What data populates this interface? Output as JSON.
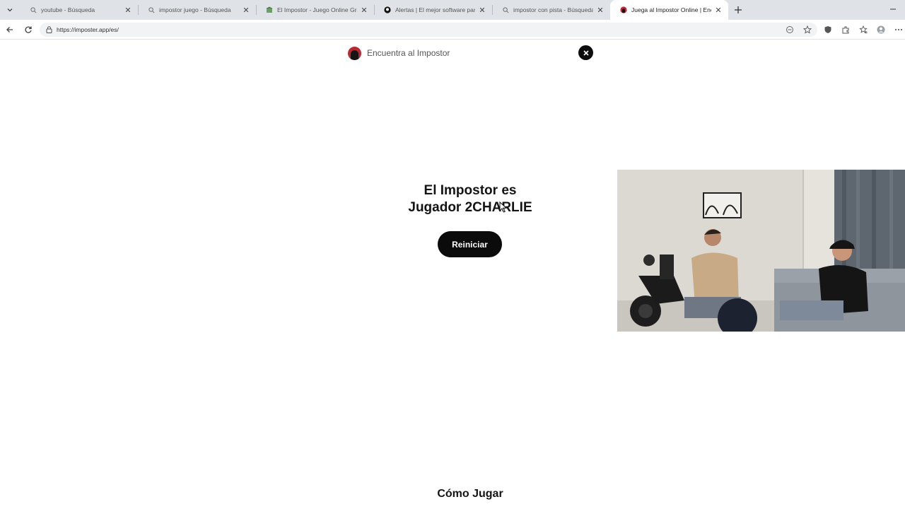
{
  "browser": {
    "tabs": [
      {
        "title": "youtube - Búsqueda",
        "icon": "search-icon",
        "active": false
      },
      {
        "title": "impostor juego - Búsqueda",
        "icon": "search-icon",
        "active": false
      },
      {
        "title": "El Impostor - Juego Online Gratis c",
        "icon": "site-icon",
        "active": false
      },
      {
        "title": "Alertas | El mejor software para po",
        "icon": "github-icon",
        "active": false
      },
      {
        "title": "impostor con pista - Búsqueda",
        "icon": "search-icon",
        "active": false
      },
      {
        "title": "Juega al Impostor Online | Encuent",
        "icon": "impostor-icon",
        "active": true
      }
    ],
    "url": "https://imposter.app/es/"
  },
  "site": {
    "title": "Encuentra al Impostor"
  },
  "result": {
    "line1": "El Impostor es",
    "line2": "Jugador 2CHARLIE"
  },
  "buttons": {
    "restart": "Reiniciar"
  },
  "section": {
    "how_to_play": "Cómo Jugar"
  },
  "colors": {
    "accent": "#0b0b0b",
    "brand_red": "#b72a35"
  }
}
